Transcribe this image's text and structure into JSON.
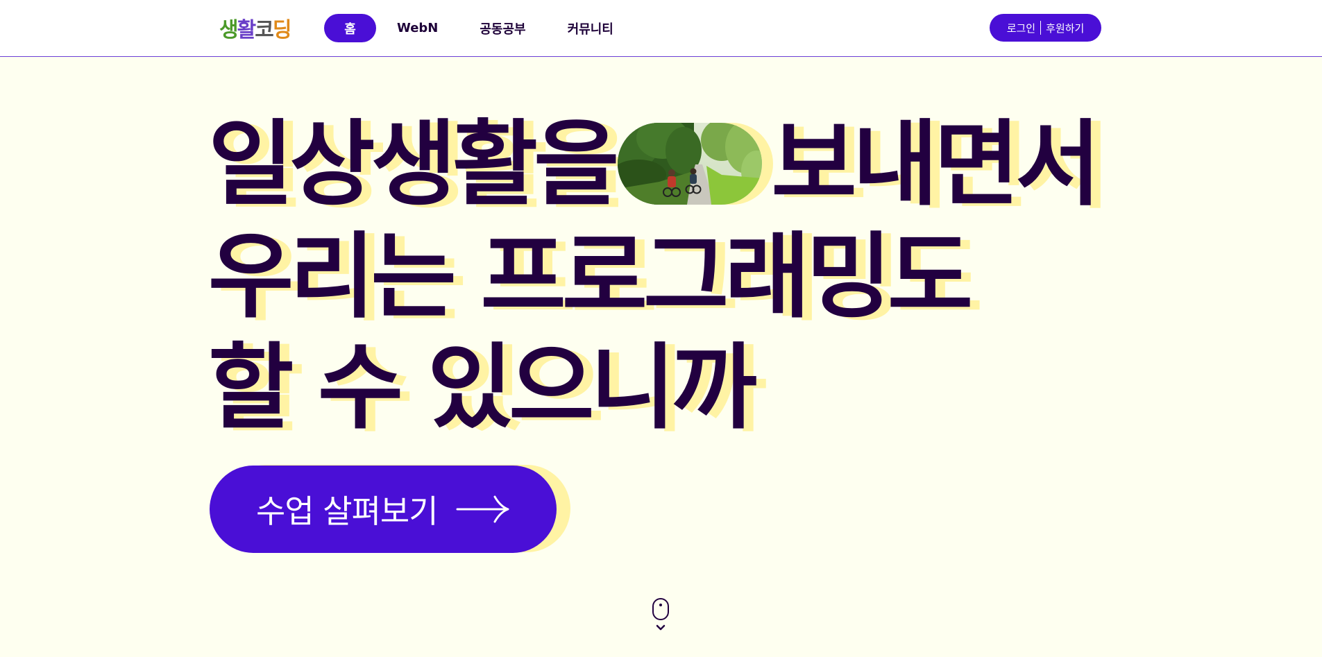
{
  "header": {
    "logo": {
      "char1": "생",
      "char2": "활",
      "char3": "코",
      "char4": "딩"
    },
    "nav": [
      {
        "label": "홈",
        "active": true
      },
      {
        "label": "WebN",
        "active": false
      },
      {
        "label": "공동공부",
        "active": false
      },
      {
        "label": "커뮤니티",
        "active": false
      }
    ],
    "auth": {
      "login_label": "로그인",
      "donate_label": "후원하기"
    }
  },
  "hero": {
    "line1_left": "일상생활을",
    "line1_right": "보내면서",
    "line2": "우리는 프로그래밍도",
    "line3": "할 수 있으니까",
    "image_icon": "cycling-photo"
  },
  "cta": {
    "label": "수업 살펴보기",
    "icon": "arrow-right-icon"
  },
  "scroll_indicator": {
    "icon": "mouse-scroll-icon"
  },
  "colors": {
    "accent": "#4a0fd6",
    "heading": "#220040",
    "highlight": "#fff3a4",
    "background": "#fefff0"
  }
}
